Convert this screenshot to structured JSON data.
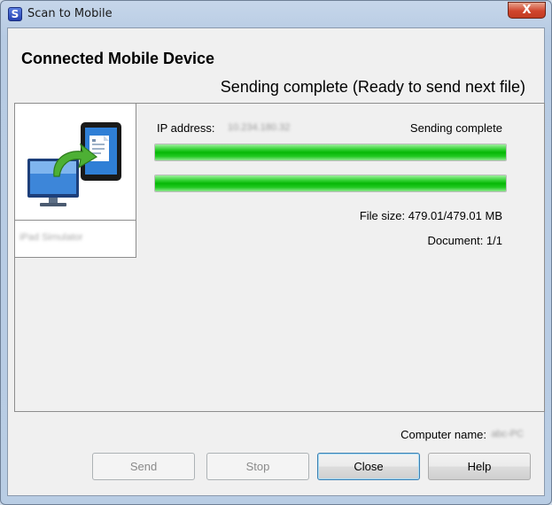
{
  "window": {
    "title": "Scan to Mobile",
    "close_glyph": "X"
  },
  "header": {
    "heading": "Connected Mobile Device",
    "status": "Sending complete (Ready to send next file)"
  },
  "device": {
    "name": "iPad Simulator",
    "icon": "computer-to-tablet-icon"
  },
  "transfer": {
    "ip_label": "IP address:",
    "ip_value": "10.234.180.32",
    "status": "Sending complete",
    "progress_file": 1.0,
    "progress_total": 1.0,
    "file_size": "File size: 479.01/479.01 MB",
    "document": "Document: 1/1"
  },
  "footer": {
    "computer_label": "Computer name:",
    "computer_value": "abc-PC"
  },
  "buttons": {
    "send": "Send",
    "stop": "Stop",
    "close": "Close",
    "help": "Help"
  },
  "colors": {
    "progress": "#06b706",
    "close_button": "#c23b22"
  }
}
